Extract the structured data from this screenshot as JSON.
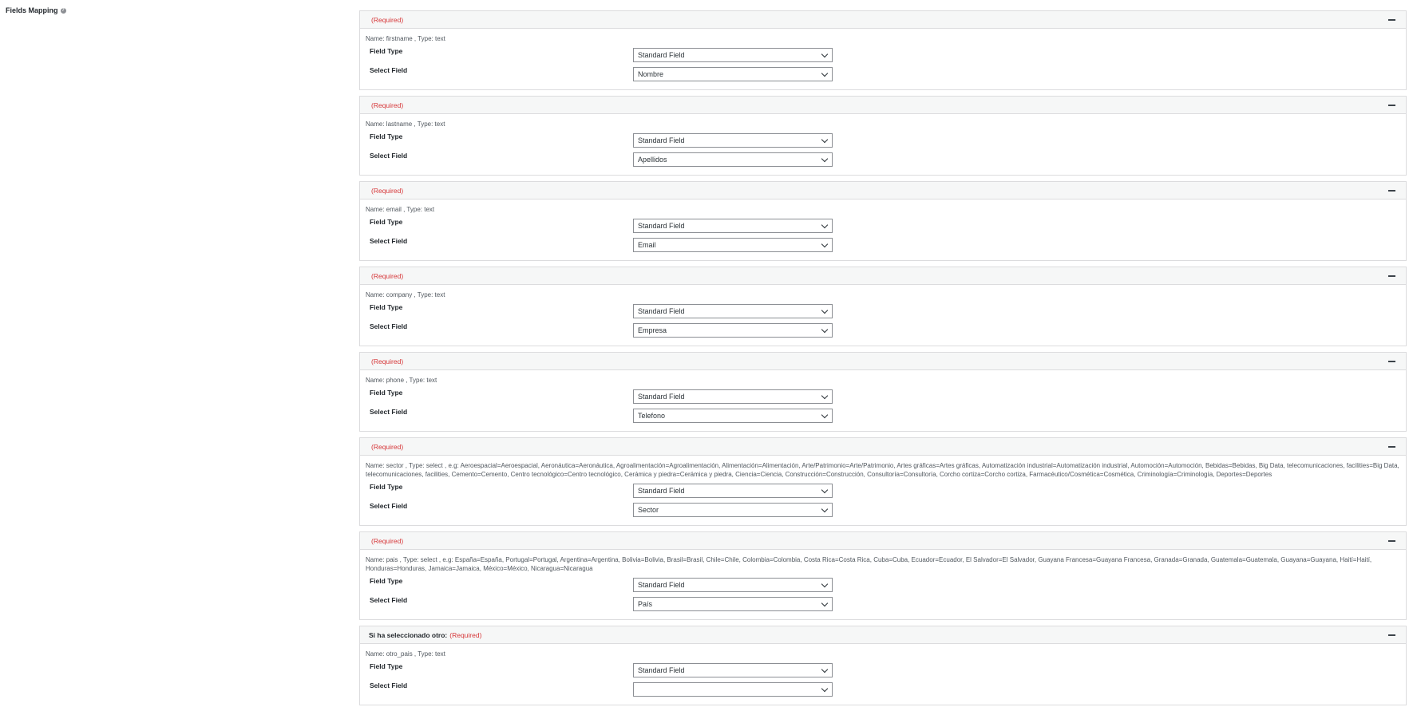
{
  "section": {
    "title": "Fields Mapping",
    "help_icon": "question-circle-icon"
  },
  "labels": {
    "field_type": "Field Type",
    "select_field": "Select Field"
  },
  "blocks": [
    {
      "label": "",
      "required": "(Required)",
      "desc": "Name: firstname , Type: text",
      "field_type": "Standard Field",
      "select_field": "Nombre"
    },
    {
      "label": "",
      "required": "(Required)",
      "desc": "Name: lastname , Type: text",
      "field_type": "Standard Field",
      "select_field": "Apellidos"
    },
    {
      "label": "",
      "required": "(Required)",
      "desc": "Name: email , Type: text",
      "field_type": "Standard Field",
      "select_field": "Email"
    },
    {
      "label": "",
      "required": "(Required)",
      "desc": "Name: company , Type: text",
      "field_type": "Standard Field",
      "select_field": "Empresa"
    },
    {
      "label": "",
      "required": "(Required)",
      "desc": "Name: phone , Type: text",
      "field_type": "Standard Field",
      "select_field": "Telefono"
    },
    {
      "label": "",
      "required": "(Required)",
      "desc": "Name: sector , Type: select , e.g: Aeroespacial=Aeroespacial, Aeronáutica=Aeronáutica, Agroalimentación=Agroalimentación, Alimentación=Alimentación, Arte/Patrimonio=Arte/Patrimonio, Artes gráficas=Artes gráficas, Automatización industrial=Automatización industrial, Automoción=Automoción, Bebidas=Bebidas, Big Data, telecomunicaciones, facilities=Big Data, telecomunicaciones, facilities, Cemento=Cemento, Centro tecnológico=Centro tecnológico, Cerámica y piedra=Cerámica y piedra, Ciencia=Ciencia, Construcción=Construcción, Consultoría=Consultoría, Corcho cortiza=Corcho cortiza, Farmacéutico/Cosmética=Cosmética, Criminología=Criminología, Deportes=Deportes",
      "field_type": "Standard Field",
      "select_field": "Sector"
    },
    {
      "label": "",
      "required": "(Required)",
      "desc": "Name: pais , Type: select , e.g: España=España, Portugal=Portugal, Argentina=Argentina, Bolivia=Bolivia, Brasil=Brasil, Chile=Chile, Colombia=Colombia, Costa Rica=Costa Rica, Cuba=Cuba, Ecuador=Ecuador, El Salvador=El Salvador, Guayana Francesa=Guayana Francesa, Granada=Granada, Guatemala=Guatemala, Guayana=Guayana, Haití=Haití, Honduras=Honduras, Jamaica=Jamaica, México=México, Nicaragua=Nicaragua",
      "field_type": "Standard Field",
      "select_field": "País"
    },
    {
      "label": "Si ha seleccionado otro:",
      "required": "(Required)",
      "desc": "Name: otro_pais , Type: text",
      "field_type": "Standard Field",
      "select_field": ""
    }
  ]
}
